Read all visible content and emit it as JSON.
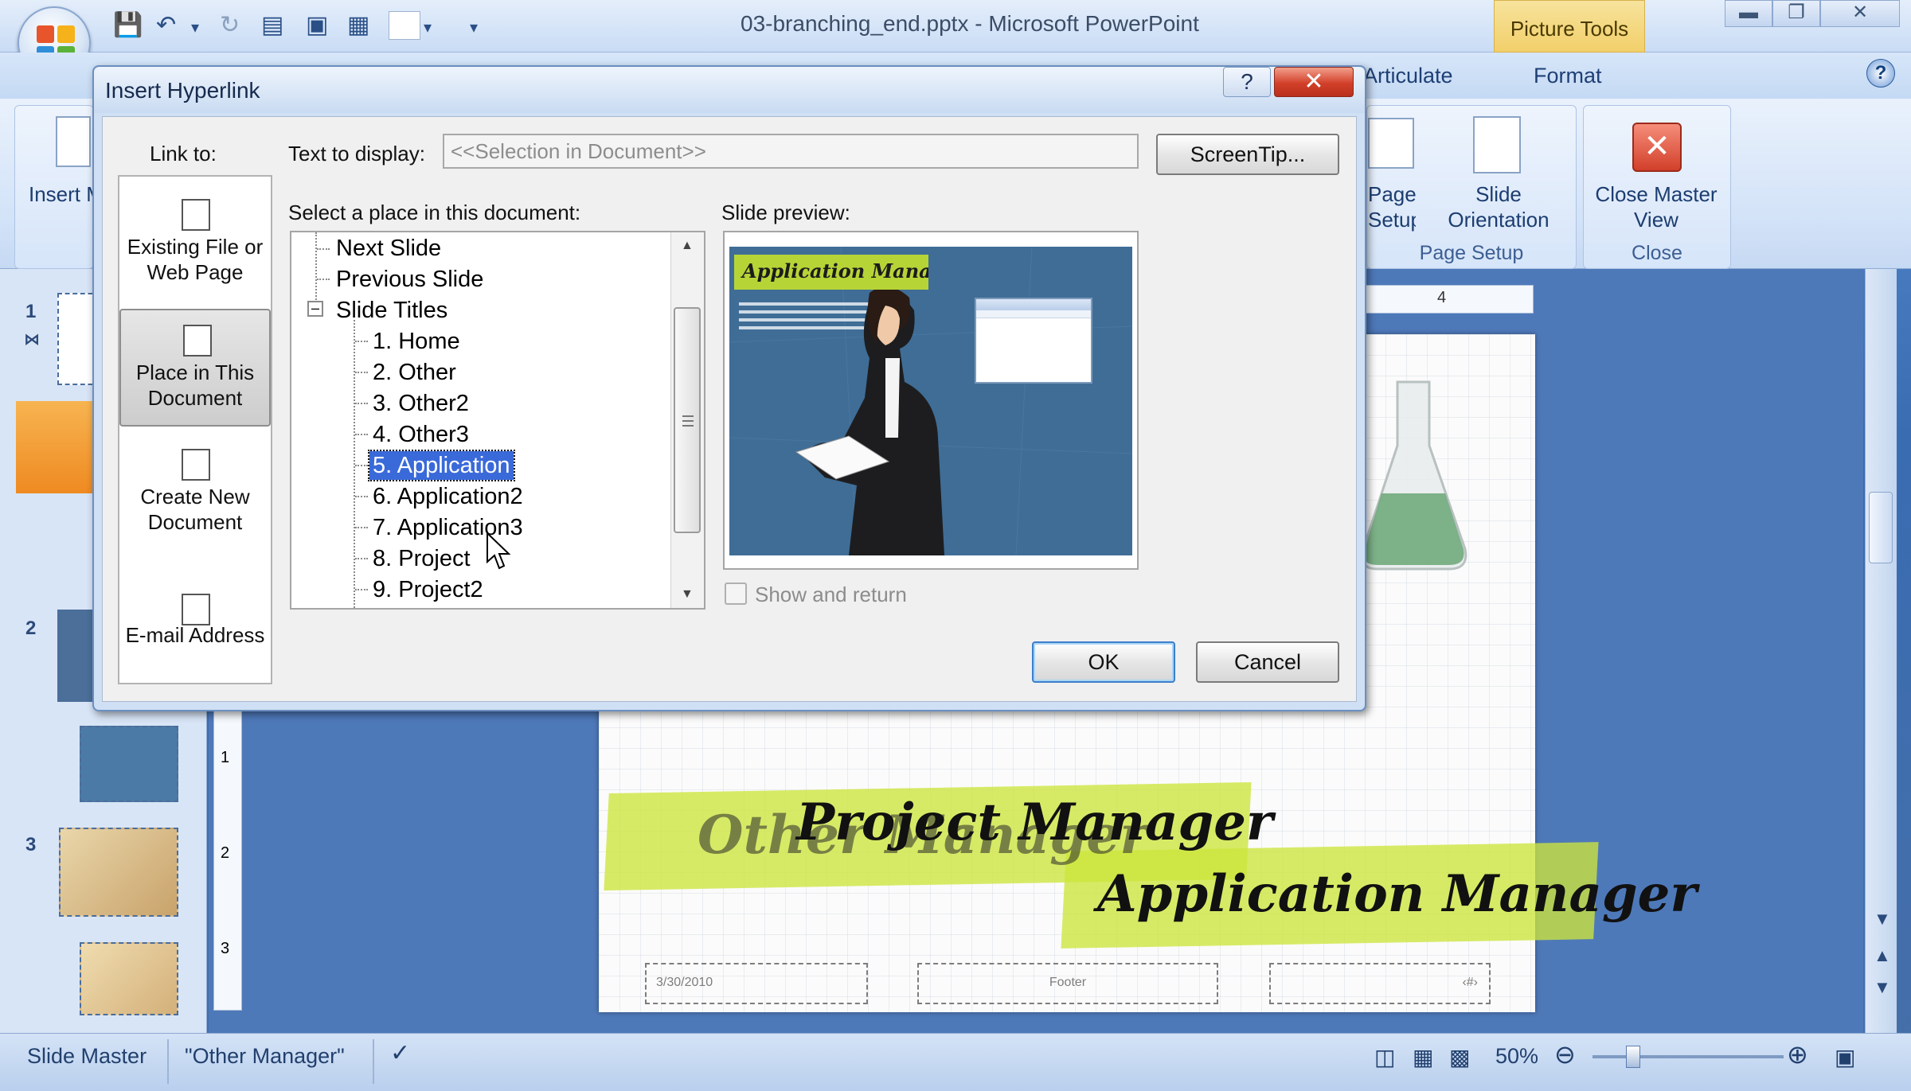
{
  "window": {
    "title": "03-branching_end.pptx - Microsoft PowerPoint",
    "contextual_tab": "Picture Tools"
  },
  "ribbon": {
    "tabs": [
      "Articulate",
      "Format"
    ],
    "insert_master_partial": "Insert Mas",
    "page_setup_partial": "Page Setup",
    "slide_orientation": "Slide Orientation",
    "close_master_view": "Close Master View",
    "groups": {
      "page_setup": "Page Setup",
      "close": "Close"
    }
  },
  "thumbnails": {
    "numbers": [
      "1",
      "2",
      "3"
    ]
  },
  "slide": {
    "title_back": "Other Manager",
    "title_mid": "Project Manager",
    "title_front": "Application Manager",
    "date": "3/30/2010",
    "footer": "Footer",
    "number": "‹#›",
    "ruler_mark": "4",
    "vruler_marks": [
      "1",
      "2",
      "3"
    ]
  },
  "statusbar": {
    "view": "Slide Master",
    "theme": "\"Other Manager\"",
    "zoom": "50%"
  },
  "dialog": {
    "title": "Insert Hyperlink",
    "help": "?",
    "link_to_label": "Link to:",
    "link_to_items": [
      {
        "label": "Existing File or Web Page",
        "selected": false
      },
      {
        "label": "Place in This Document",
        "selected": true
      },
      {
        "label": "Create New Document",
        "selected": false
      },
      {
        "label": "E-mail Address",
        "selected": false
      }
    ],
    "text_to_display_label": "Text to display:",
    "text_to_display_value": "<<Selection in Document>>",
    "screentip_button": "ScreenTip...",
    "select_place_label": "Select a place in this document:",
    "tree": [
      {
        "label": "Next Slide",
        "level": 0
      },
      {
        "label": "Previous Slide",
        "level": 0
      },
      {
        "label": "Slide Titles",
        "level": 0,
        "expanded": true
      },
      {
        "label": "1. Home",
        "level": 1
      },
      {
        "label": "2. Other",
        "level": 1
      },
      {
        "label": "3. Other2",
        "level": 1
      },
      {
        "label": "4. Other3",
        "level": 1
      },
      {
        "label": "5. Application",
        "level": 1,
        "selected": true
      },
      {
        "label": "6. Application2",
        "level": 1
      },
      {
        "label": "7. Application3",
        "level": 1
      },
      {
        "label": "8. Project",
        "level": 1
      },
      {
        "label": "9. Project2",
        "level": 1
      }
    ],
    "slide_preview_label": "Slide preview:",
    "preview_title": "Application Manager",
    "show_and_return_label": "Show and return",
    "show_and_return_checked": false,
    "ok_button": "OK",
    "cancel_button": "Cancel"
  },
  "colors": {
    "selection": "#3a6ad9",
    "banner": "#cde63c",
    "close_red": "#d2402a"
  }
}
